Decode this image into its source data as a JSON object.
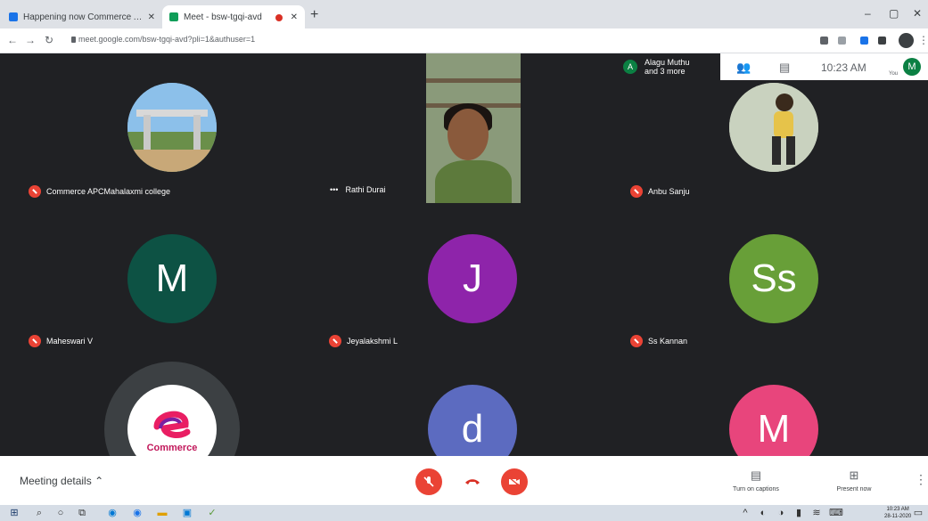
{
  "browser": {
    "tabs": [
      {
        "title": "Happening now Commerce AP...",
        "active": false
      },
      {
        "title": "Meet - bsw-tgqi-avd",
        "active": true
      }
    ],
    "url": "meet.google.com/bsw-tgqi-avd?pli=1&authuser=1"
  },
  "meet": {
    "participants": [
      {
        "name": "Commerce APCMahalaxmi college",
        "muted": true,
        "avatar_type": "photo-gate"
      },
      {
        "name": "Rathi Durai",
        "muted": false,
        "avatar_type": "video"
      },
      {
        "name": "Anbu Sanju",
        "muted": true,
        "avatar_type": "photo-person"
      },
      {
        "name": "Maheswari V",
        "muted": true,
        "avatar_letter": "M",
        "avatar_color": "#0d5244"
      },
      {
        "name": "Jeyalakshmi L",
        "muted": true,
        "avatar_letter": "J",
        "avatar_color": "#8e24aa"
      },
      {
        "name": "Ss Kannan",
        "muted": true,
        "avatar_letter": "Ss",
        "avatar_color": "#689f38"
      },
      {
        "name": "",
        "avatar_type": "logo",
        "logo_text": "Commerce"
      },
      {
        "name": "",
        "avatar_letter": "d",
        "avatar_color": "#5c6bc0"
      },
      {
        "name": "",
        "avatar_letter": "M",
        "avatar_color": "#e8457c"
      }
    ],
    "presenting_label": "Alagu Muthu\nand 3 more",
    "presenting_icon": "A",
    "time": "10:23 AM",
    "self_label": "You",
    "self_initial": "M",
    "meeting_details": "Meeting details",
    "captions_label": "Turn on captions",
    "present_label": "Present now"
  },
  "taskbar": {
    "time": "10:23 AM",
    "date": "28-11-2020"
  },
  "colors": {
    "end_call": "#d93025",
    "mic_off": "#ea4335"
  }
}
